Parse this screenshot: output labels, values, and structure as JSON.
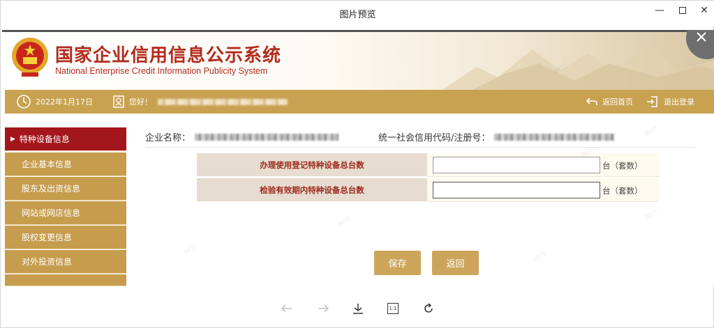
{
  "window": {
    "title": "图片预览",
    "controls": {
      "minimize": "—",
      "close": "✕"
    }
  },
  "site": {
    "title": "国家企业信用信息公示系统",
    "subtitle": "National Enterprise Credit Information Publicity System"
  },
  "navbar": {
    "date": "2022年1月17日",
    "greeting": "您好！",
    "home_label": "返回首页",
    "logout_label": "退出登录"
  },
  "sidebar": {
    "items": [
      {
        "label": "特种设备信息",
        "active": true
      },
      {
        "label": "企业基本信息",
        "active": false
      },
      {
        "label": "股东及出资信息",
        "active": false
      },
      {
        "label": "网站或网店信息",
        "active": false
      },
      {
        "label": "股权变更信息",
        "active": false
      },
      {
        "label": "对外投资信息",
        "active": false
      }
    ]
  },
  "content": {
    "company_name_label": "企业名称：",
    "credit_code_label": "统一社会信用代码/注册号：",
    "form": {
      "rows": [
        {
          "label": "办理使用登记特种设备总台数",
          "value": "",
          "unit": "台（套数）"
        },
        {
          "label": "检验有效期内特种设备总台数",
          "value": "",
          "unit": "台（套数）"
        }
      ]
    },
    "buttons": {
      "save": "保存",
      "back": "返回"
    }
  },
  "colors": {
    "accent_gold": "#c8a250",
    "active_red": "#a3161b",
    "title_red": "#b32b1c"
  },
  "toolbar": {
    "icons": [
      "arrow-left-icon",
      "arrow-right-icon",
      "download-icon",
      "actual-size-icon",
      "rotate-icon"
    ],
    "actual_size_label": "1:1"
  },
  "watermark_text": "8877"
}
